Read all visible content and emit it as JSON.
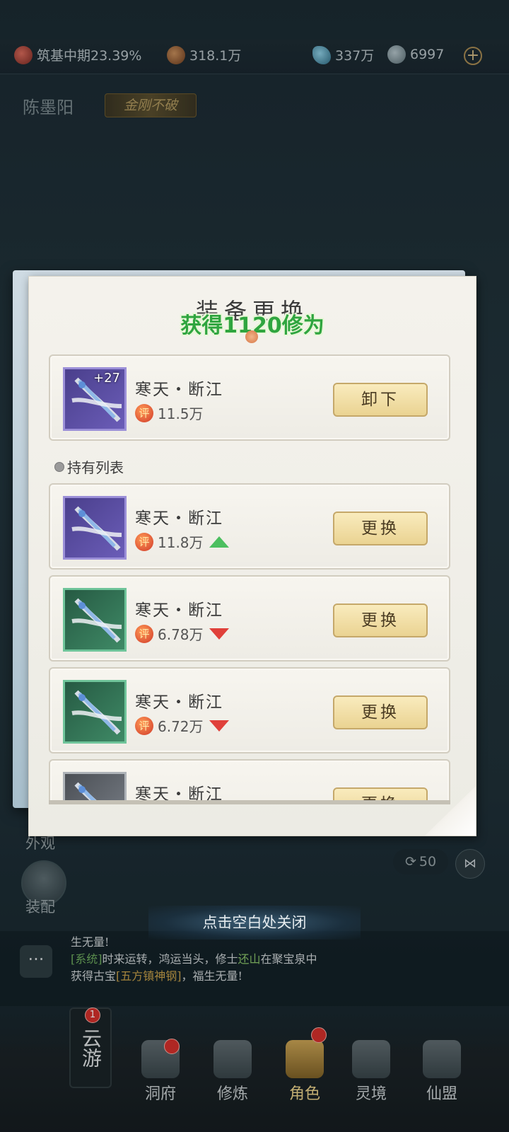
{
  "topbar": {
    "realm": "筑基中期23.39%",
    "power": "318.1万",
    "spirit_stones": "337万",
    "coins": "6997",
    "plus": "+"
  },
  "player": {
    "name": "陈墨阳",
    "title_badge": "金刚不破",
    "bg_power": "318.1万"
  },
  "dialog": {
    "title": "装备更换",
    "toast": "获得1120修为",
    "equipped": {
      "name": "寒天・断江",
      "enhance": "+27",
      "score_icon": "评",
      "score": "11.5万",
      "button": "卸下",
      "quality": "purple"
    },
    "section_label": "持有列表",
    "items": [
      {
        "name": "寒天・断江",
        "score_icon": "评",
        "score": "11.8万",
        "trend": "up",
        "button": "更换",
        "quality": "purple"
      },
      {
        "name": "寒天・断江",
        "score_icon": "评",
        "score": "6.78万",
        "trend": "down",
        "button": "更换",
        "quality": "green"
      },
      {
        "name": "寒天・断江",
        "score_icon": "评",
        "score": "6.72万",
        "trend": "down",
        "button": "更换",
        "quality": "green"
      },
      {
        "name": "寒天・断江",
        "score_icon": "评",
        "score": "",
        "trend": "",
        "button": "更换",
        "quality": "gray"
      }
    ]
  },
  "side": {
    "appearance_label": "外观",
    "equip_label": "装配",
    "share_count": "50"
  },
  "close_hint": "点击空白处关闭",
  "chat": {
    "line1": "生无量!",
    "sys_tag": "[系统]",
    "line2a": "时来运转，鸿运当头，修士",
    "player": "还山",
    "line2b": "在聚宝泉中获得古宝",
    "item": "[五方镇神钢]",
    "line2c": "，福生无量!"
  },
  "bottom_nav": {
    "yunyou": "云游",
    "yunyou_badge": "1",
    "items": [
      {
        "label": "洞府",
        "icon": "cave-icon"
      },
      {
        "label": "修炼",
        "icon": "meditate-icon"
      },
      {
        "label": "角色",
        "icon": "character-icon"
      },
      {
        "label": "灵境",
        "icon": "realm-icon"
      },
      {
        "label": "仙盟",
        "icon": "alliance-icon"
      }
    ]
  },
  "colors": {
    "accent_gold": "#ead392",
    "toast_green": "#2fa53f",
    "up_green": "#4cbf5f",
    "down_red": "#e0403a"
  }
}
